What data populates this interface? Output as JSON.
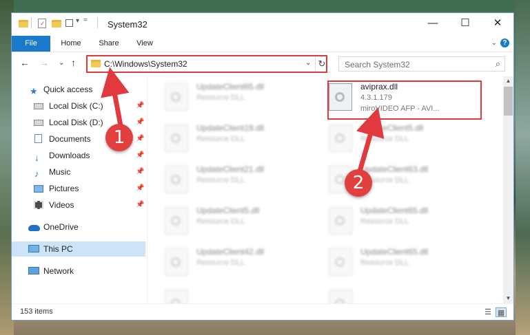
{
  "window": {
    "title": "System32",
    "controls": {
      "minimize": "—",
      "maximize": "☐",
      "close": "✕"
    }
  },
  "ribbon": {
    "tabs": [
      {
        "label": "File"
      },
      {
        "label": "Home"
      },
      {
        "label": "Share"
      },
      {
        "label": "View"
      }
    ],
    "collapse_glyph": "⌄",
    "help_glyph": "?"
  },
  "navbar": {
    "back": "←",
    "forward": "→",
    "recent": "⌄",
    "up": "↑",
    "address": "C:\\Windows\\System32",
    "address_dropdown": "⌄",
    "refresh": "↻",
    "search_placeholder": "Search System32",
    "search_icon": "⌕"
  },
  "sidebar": {
    "items": [
      {
        "label": "Quick access",
        "icon": "star-icon",
        "pinned": false
      },
      {
        "label": "Local Disk (C:)",
        "icon": "drive-icon",
        "pinned": true
      },
      {
        "label": "Local Disk (D:)",
        "icon": "drive-icon",
        "pinned": true
      },
      {
        "label": "Documents",
        "icon": "documents-icon",
        "pinned": true
      },
      {
        "label": "Downloads",
        "icon": "download-arrow-icon",
        "pinned": true
      },
      {
        "label": "Music",
        "icon": "music-note-icon",
        "pinned": true
      },
      {
        "label": "Pictures",
        "icon": "pictures-icon",
        "pinned": true
      },
      {
        "label": "Videos",
        "icon": "videos-icon",
        "pinned": true
      },
      {
        "label": "OneDrive",
        "icon": "cloud-icon",
        "pinned": false
      },
      {
        "label": "This PC",
        "icon": "computer-icon",
        "pinned": false,
        "selected": true
      },
      {
        "label": "Network",
        "icon": "network-icon",
        "pinned": false
      }
    ],
    "pin_glyph": "📌"
  },
  "files": {
    "left_column": [
      {
        "name": "UpdateClient65.dll",
        "type": "Resource DLL"
      },
      {
        "name": "UpdateClient19.dll",
        "type": "Resource DLL"
      },
      {
        "name": "UpdateClient21.dll",
        "type": "Resource DLL"
      },
      {
        "name": "UpdateClient5.dll",
        "type": "Resource DLL"
      },
      {
        "name": "UpdateClient42.dll",
        "type": "Resource DLL"
      },
      {
        "name": "",
        "type": ""
      }
    ],
    "right_column": [
      {
        "name": "aviprax.dll",
        "version": "4.3.1.179",
        "description": "miroVIDEO AFP - AVI...",
        "highlighted": true
      },
      {
        "name": "UpdateClient5.dll",
        "type": "Resource DLL"
      },
      {
        "name": "UpdateClient63.dll",
        "type": "Resource DLL"
      },
      {
        "name": "UpdateClient65.dll",
        "type": "Resource DLL"
      },
      {
        "name": "UpdateClient65.dll",
        "type": "Resource DLL"
      },
      {
        "name": "",
        "type": ""
      }
    ]
  },
  "status": {
    "item_count": "153 items"
  },
  "annotations": {
    "step1": "1",
    "step2": "2",
    "color": "#e03a3e"
  }
}
